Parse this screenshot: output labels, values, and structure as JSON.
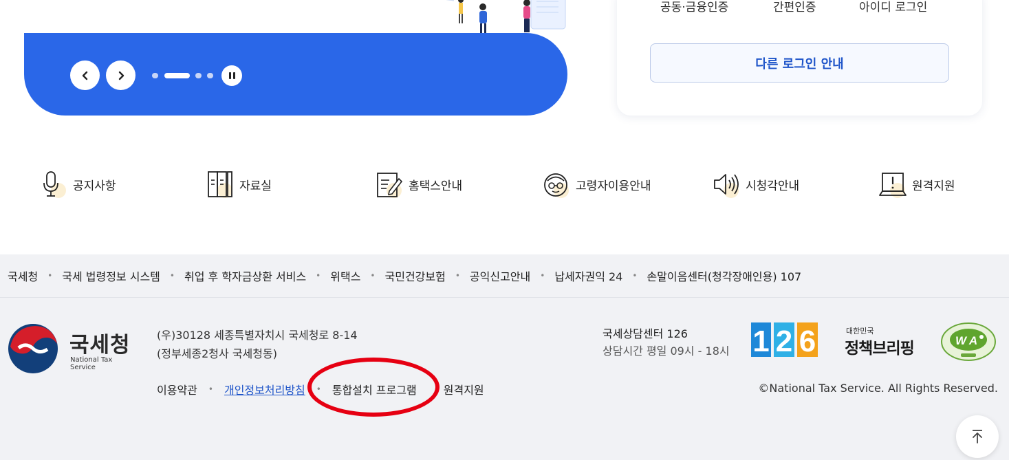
{
  "banner": {
    "prev_label": "‹",
    "next_label": "›"
  },
  "login": {
    "tabs": [
      "공동·금융인증",
      "간편인증",
      "아이디 로그인"
    ],
    "other_login": "다른 로그인 안내"
  },
  "quick_menu": [
    {
      "label": "공지사항",
      "icon": "microphone-icon"
    },
    {
      "label": "자료실",
      "icon": "binder-icon"
    },
    {
      "label": "홈택스안내",
      "icon": "document-pen-icon"
    },
    {
      "label": "고령자이용안내",
      "icon": "elderly-face-icon"
    },
    {
      "label": "시청각안내",
      "icon": "speaker-icon"
    },
    {
      "label": "원격지원",
      "icon": "laptop-alert-icon"
    }
  ],
  "footer": {
    "related_links": [
      "국세청",
      "국세 법령정보 시스템",
      "취업 후 학자금상환 서비스",
      "위택스",
      "국민건강보험",
      "공익신고안내",
      "납세자권익 24",
      "손말이음센터(청각장애인용) 107"
    ],
    "logo": {
      "name": "국세청",
      "english": "National Tax Service"
    },
    "address_line1": "(우)30128 세종특별자치시 국세청로 8-14",
    "address_line2": "(정부세종2청사 국세청동)",
    "links": {
      "terms": "이용약관",
      "privacy": "개인정보처리방침",
      "install": "통합설치 프로그램",
      "remote": "원격지원"
    },
    "center_title": "국세상담센터 126",
    "center_hours": "상담시간 평일 09시 - 18시",
    "badges": {
      "number": "126",
      "briefing_small": "대한민국",
      "briefing_big": "정책브리핑",
      "wa": "WA"
    },
    "copyright": "©National Tax Service. All Rights Reserved."
  },
  "colors": {
    "primary": "#2a67e8",
    "link": "#1f55c9",
    "highlight": "#e60012",
    "footer_bg": "#f1f2f5"
  }
}
